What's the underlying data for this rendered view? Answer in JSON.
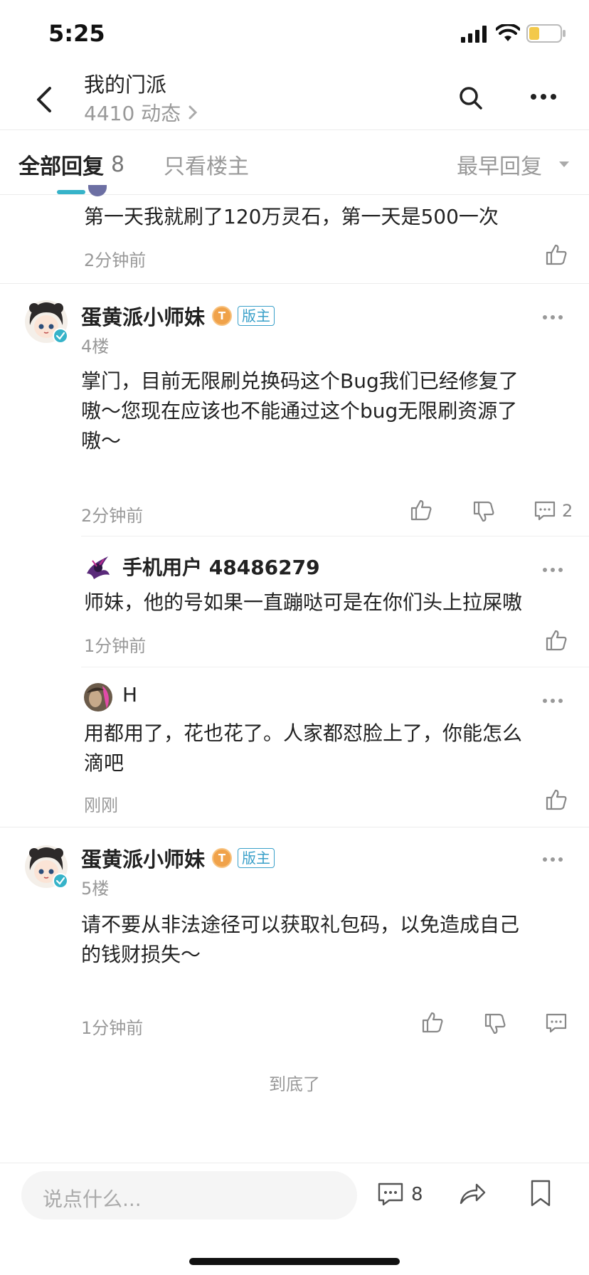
{
  "status_bar": {
    "time": "5:25"
  },
  "header": {
    "title": "我的门派",
    "subtitle": "4410 动态"
  },
  "tabs": {
    "all_replies_label": "全部回复",
    "all_replies_count": "8",
    "only_op_label": "只看楼主",
    "sort_label": "最早回复"
  },
  "partial_reply": {
    "text": "第一天我就刷了120万灵石，第一天是500一次",
    "time": "2分钟前"
  },
  "floor4": {
    "author": "蛋黄派小师妹",
    "level_badge": "T",
    "moderator_badge": "版主",
    "floor_label": "4楼",
    "text_line1": "掌门，目前无限刷兑换码这个Bug我们已经修复了",
    "text_line2": "嗷～您现在应该也不能通过这个bug无限刷资源了",
    "text_line3": "嗷～",
    "time": "2分钟前",
    "comment_count": "2",
    "sub_replies": [
      {
        "author": "手机用户 48486279",
        "text": "师妹，他的号如果一直蹦哒可是在你们头上拉屎嗷",
        "time": "1分钟前"
      },
      {
        "author": "H",
        "text_line1": "用都用了，花也花了。人家都怼脸上了，你能怎么",
        "text_line2": "滴吧",
        "time": "刚刚"
      }
    ]
  },
  "floor5": {
    "author": "蛋黄派小师妹",
    "level_badge": "T",
    "moderator_badge": "版主",
    "floor_label": "5楼",
    "text_line1": "请不要从非法途径可以获取礼包码，以免造成自己",
    "text_line2": "的钱财损失～",
    "time": "1分钟前"
  },
  "end_text": "到底了",
  "bottom_bar": {
    "input_placeholder": "说点什么...",
    "comment_count": "8"
  },
  "colors": {
    "accent": "#36b3c9",
    "mod_badge": "#3aa0c9",
    "level_badge": "#f0a24a"
  }
}
